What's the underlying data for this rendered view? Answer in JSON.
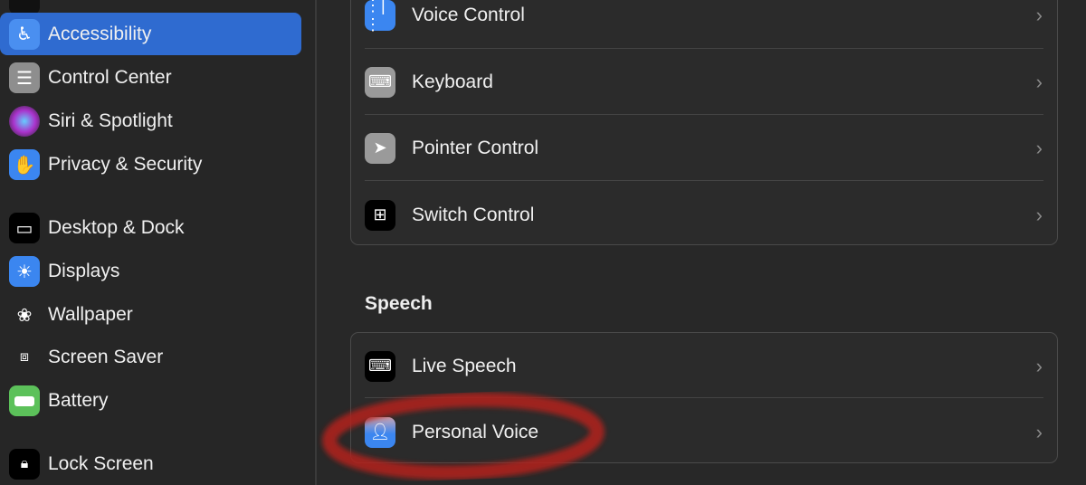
{
  "sidebar": {
    "items": [
      {
        "label": "Accessibility",
        "icon": "accessibility-icon",
        "selected": true
      },
      {
        "label": "Control Center",
        "icon": "control-center-icon"
      },
      {
        "label": "Siri & Spotlight",
        "icon": "siri-icon"
      },
      {
        "label": "Privacy & Security",
        "icon": "hand-icon"
      },
      {
        "label": "Desktop & Dock",
        "icon": "dock-icon"
      },
      {
        "label": "Displays",
        "icon": "sun-icon"
      },
      {
        "label": "Wallpaper",
        "icon": "flower-icon"
      },
      {
        "label": "Screen Saver",
        "icon": "screen-saver-icon"
      },
      {
        "label": "Battery",
        "icon": "battery-icon"
      },
      {
        "label": "Lock Screen",
        "icon": "lock-icon"
      }
    ]
  },
  "main": {
    "motor_rows": [
      {
        "label": "Voice Control",
        "icon": "voice-control-icon"
      },
      {
        "label": "Keyboard",
        "icon": "keyboard-icon"
      },
      {
        "label": "Pointer Control",
        "icon": "pointer-icon"
      },
      {
        "label": "Switch Control",
        "icon": "switch-control-icon"
      }
    ],
    "speech_title": "Speech",
    "speech_rows": [
      {
        "label": "Live Speech",
        "icon": "live-speech-icon"
      },
      {
        "label": "Personal Voice",
        "icon": "personal-voice-icon"
      }
    ],
    "chevron": "›"
  },
  "colors": {
    "accent": "#2f6bd0",
    "annotation": "#b3231b"
  }
}
